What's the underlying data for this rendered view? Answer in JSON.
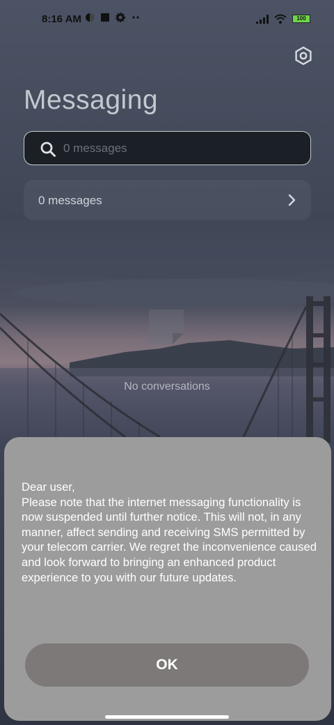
{
  "status_bar": {
    "time": "8:16 AM",
    "battery": "100"
  },
  "header": {
    "title": "Messaging",
    "settings_icon": "settings-icon"
  },
  "search": {
    "placeholder": "0 messages",
    "value": ""
  },
  "conversations": {
    "label": "0 messages"
  },
  "empty_state": {
    "text": "No conversations"
  },
  "dialog": {
    "message": "Dear user,\nPlease note that the internet messaging functionality is now suspended until further notice. This will not, in any manner, affect sending and receiving SMS permitted by your telecom carrier. We regret the inconvenience caused and look forward to bringing an enhanced product experience to you with our future updates.",
    "ok_label": "OK"
  },
  "colors": {
    "dialog_bg": "#9c9c9c",
    "ok_button_bg": "#7d7979",
    "title_color": "#c4c8cf"
  }
}
